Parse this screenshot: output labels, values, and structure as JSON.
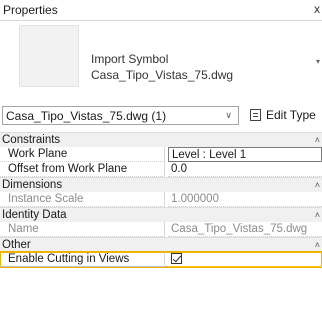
{
  "panel": {
    "title": "Properties",
    "close_glyph": "x"
  },
  "type_selector": {
    "family_line1": "Import Symbol",
    "family_line2": "Casa_Tipo_Vistas_75.dwg",
    "dropdown_arrow": "▾"
  },
  "instance_selector": {
    "value": "Casa_Tipo_Vistas_75.dwg (1)",
    "chevron": "∨",
    "edit_type_label": "Edit Type"
  },
  "sections": {
    "constraints": {
      "label": "Constraints",
      "collapse": "˄",
      "rows": [
        {
          "key": "Work Plane",
          "value": "Level : Level 1"
        },
        {
          "key": "Offset from Work Plane",
          "value": "0.0"
        }
      ]
    },
    "dimensions": {
      "label": "Dimensions",
      "collapse": "˄",
      "rows": [
        {
          "key": "Instance Scale",
          "value": "1.000000"
        }
      ]
    },
    "identity": {
      "label": "Identity Data",
      "collapse": "˄",
      "rows": [
        {
          "key": "Name",
          "value": "Casa_Tipo_Vistas_75.dwg"
        }
      ]
    },
    "other": {
      "label": "Other",
      "collapse": "˄",
      "rows": [
        {
          "key": "Enable Cutting in Views",
          "checked": true
        }
      ]
    }
  },
  "colors": {
    "highlight": "#f0b400",
    "section_bg": "#f0f0f0",
    "readonly_text": "#8c8c8c"
  }
}
